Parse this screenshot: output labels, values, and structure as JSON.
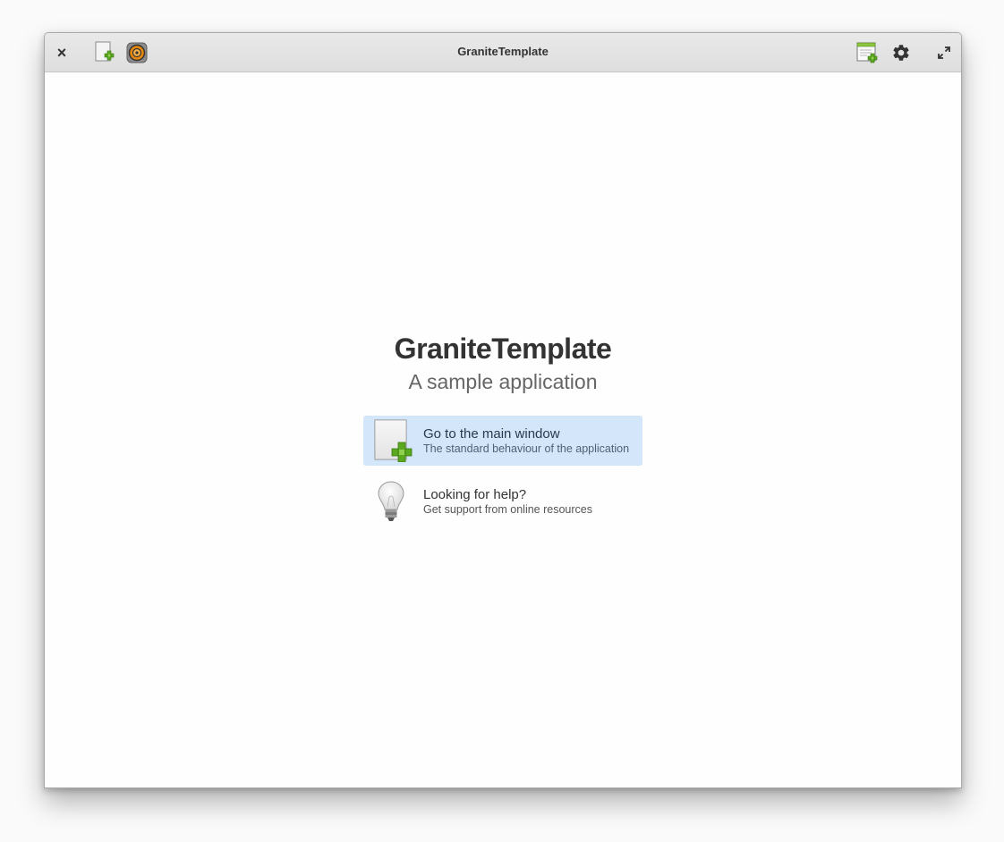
{
  "window": {
    "title": "GraniteTemplate"
  },
  "headerbar": {
    "left_icons": [
      "close-icon",
      "new-document-icon",
      "audio-speaker-icon"
    ],
    "right_icons": [
      "new-tab-icon",
      "gear-icon",
      "maximize-icon"
    ],
    "close_glyph": "×"
  },
  "welcome": {
    "title": "GraniteTemplate",
    "subtitle": "A sample application",
    "options": [
      {
        "title": "Go to the main window",
        "description": "The standard behaviour of the application",
        "icon": "new-document-icon",
        "selected": true
      },
      {
        "title": "Looking for help?",
        "description": "Get support from online resources",
        "icon": "lightbulb-icon",
        "selected": false
      }
    ]
  },
  "colors": {
    "selected_option_bg": "#d4e7fa",
    "headerbar_bg": "#e3e3e3",
    "window_bg": "#fefefe"
  }
}
